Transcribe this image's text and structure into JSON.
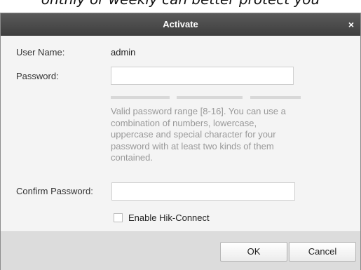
{
  "background_text": "onthly or weekly can better protect you",
  "dialog": {
    "title": "Activate",
    "close_glyph": "×",
    "user_name_label": "User Name:",
    "user_name_value": "admin",
    "password_label": "Password:",
    "password_value": "",
    "hint": "Valid password range [8-16]. You can use a combination of numbers, lowercase, uppercase and special character for your password with at least two kinds of them contained.",
    "confirm_label": "Confirm Password:",
    "confirm_value": "",
    "hik_connect_label": "Enable Hik-Connect",
    "hik_connect_checked": false,
    "ok_label": "OK",
    "cancel_label": "Cancel"
  },
  "colors": {
    "titlebar": "#4a4a4a",
    "dialog_bg": "#f4f4f4",
    "footer_bg": "#dcdcdc",
    "hint_text": "#999999"
  }
}
